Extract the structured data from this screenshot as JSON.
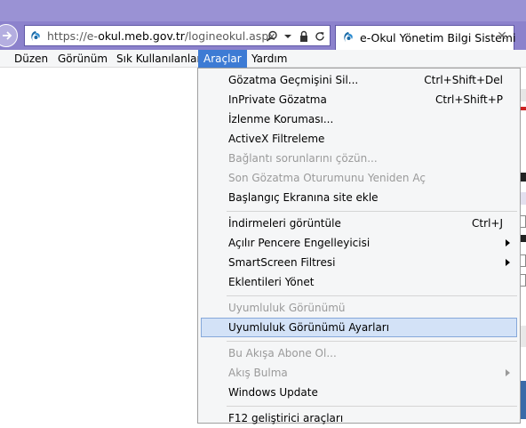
{
  "address_bar": {
    "url_prefix": "https://e-",
    "url_domain": "okul.meb.gov.tr",
    "url_path": "/logineokul.aspx",
    "tools": [
      "search-icon",
      "dropdown-arrow-icon",
      "lock-icon",
      "refresh-icon"
    ]
  },
  "tab": {
    "title": "e-Okul Yönetim Bilgi Sistemi",
    "close": "✕"
  },
  "menubar": {
    "items": [
      "Düzen",
      "Görünüm",
      "Sık Kullanılanlar",
      "Araçlar",
      "Yardım"
    ],
    "active": "Araçlar"
  },
  "tools_menu": {
    "items": [
      {
        "label": "Gözatma Geçmişini Sil...",
        "shortcut": "Ctrl+Shift+Del",
        "enabled": true
      },
      {
        "label": "InPrivate Gözatma",
        "shortcut": "Ctrl+Shift+P",
        "enabled": true
      },
      {
        "label": "İzlenme Koruması...",
        "shortcut": "",
        "enabled": true
      },
      {
        "label": "ActiveX Filtreleme",
        "shortcut": "",
        "enabled": true
      },
      {
        "label": "Bağlantı sorunlarını çözün...",
        "shortcut": "",
        "enabled": false
      },
      {
        "label": "Son Gözatma Oturumunu Yeniden Aç",
        "shortcut": "",
        "enabled": false
      },
      {
        "label": "Başlangıç Ekranına site ekle",
        "shortcut": "",
        "enabled": true
      },
      {
        "label": "İndirmeleri görüntüle",
        "shortcut": "Ctrl+J",
        "enabled": true
      },
      {
        "label": "Açılır Pencere Engelleyicisi",
        "shortcut": "",
        "enabled": true,
        "submenu": true
      },
      {
        "label": "SmartScreen Filtresi",
        "shortcut": "",
        "enabled": true,
        "submenu": true
      },
      {
        "label": "Eklentileri Yönet",
        "shortcut": "",
        "enabled": true
      },
      {
        "label": "Uyumluluk Görünümü",
        "shortcut": "",
        "enabled": false
      },
      {
        "label": "Uyumluluk Görünümü Ayarları",
        "shortcut": "",
        "enabled": true,
        "highlighted": true
      },
      {
        "label": "Bu Akışa Abone Ol...",
        "shortcut": "",
        "enabled": false
      },
      {
        "label": "Akış Bulma",
        "shortcut": "",
        "enabled": false,
        "submenu": true
      },
      {
        "label": "Windows Update",
        "shortcut": "",
        "enabled": true
      },
      {
        "label": "F12 geliştirici araçları",
        "shortcut": "",
        "enabled": true
      }
    ]
  },
  "colors": {
    "chrome": "#8c82cc",
    "menu_active": "#3d7bd4",
    "menu_hover": "#d3e2f7",
    "disabled_text": "#9a9a9a"
  }
}
